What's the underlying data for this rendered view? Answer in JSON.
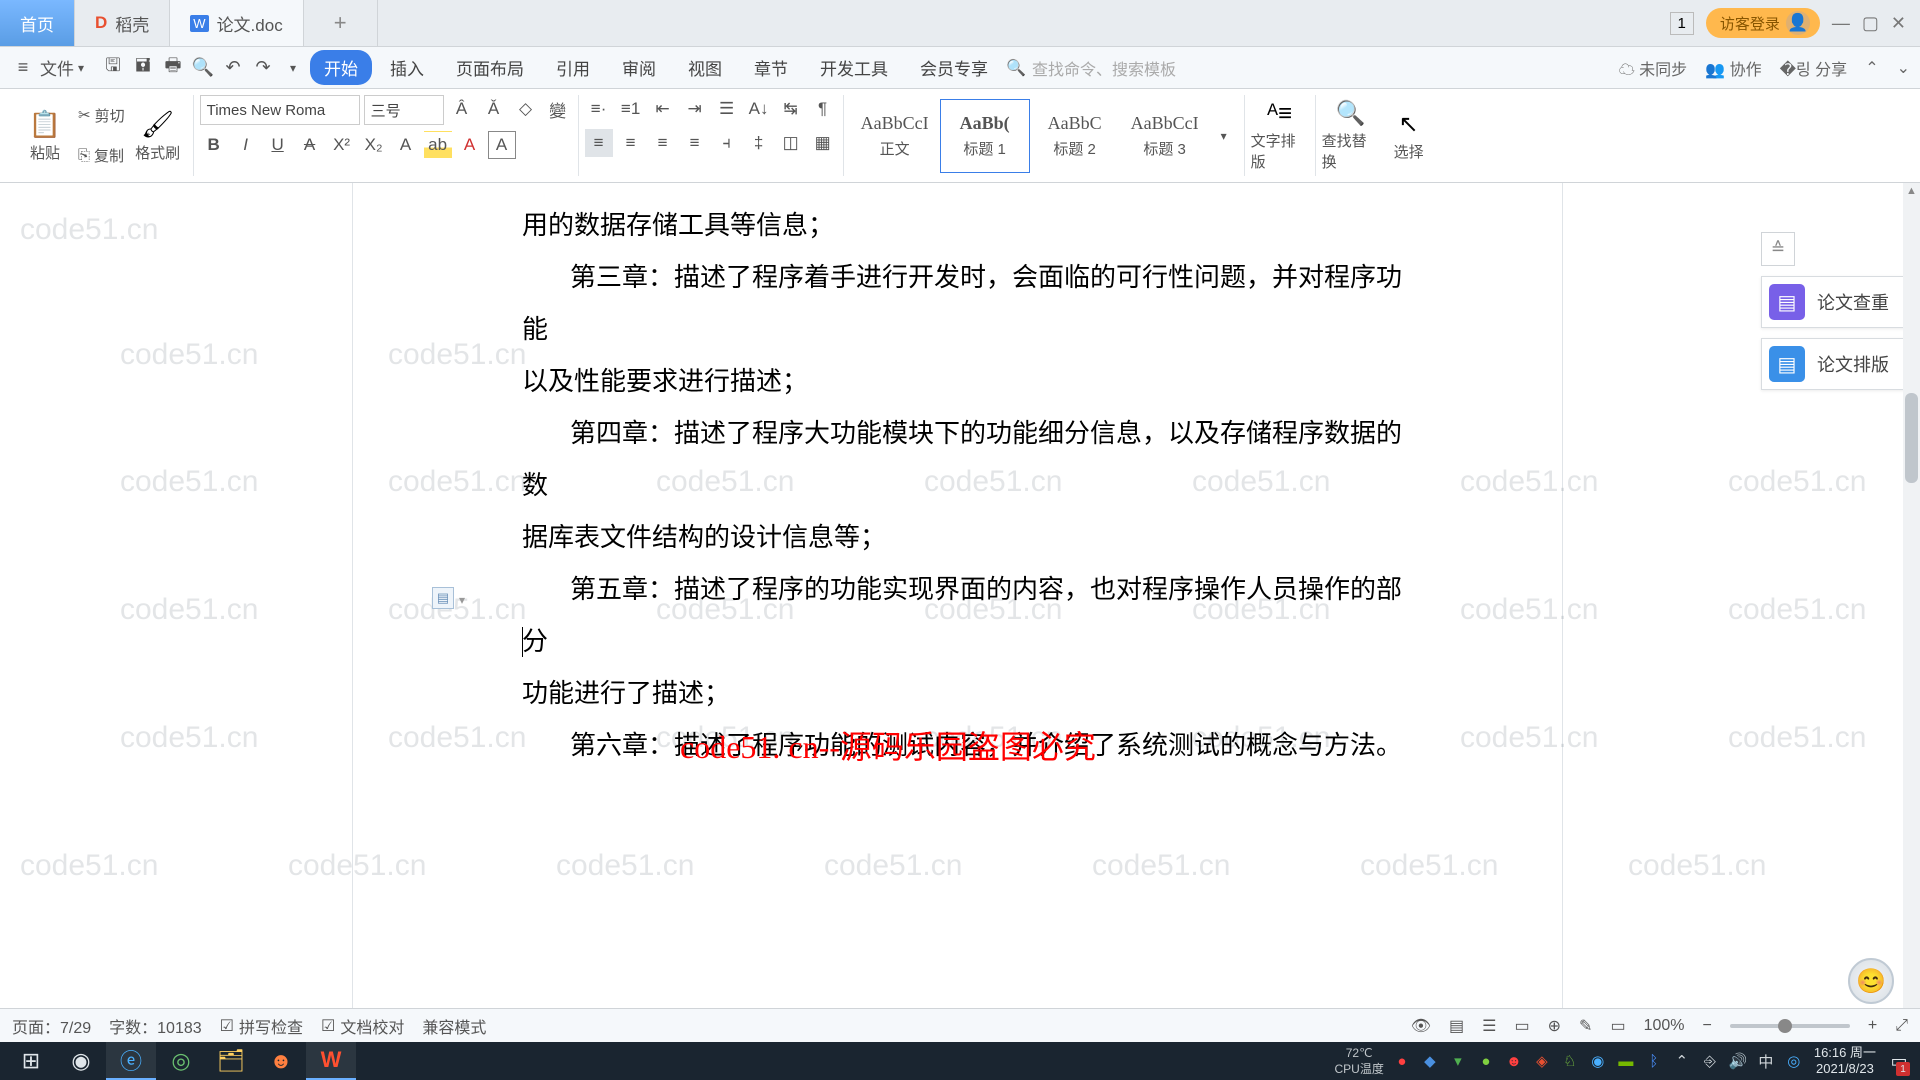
{
  "tabs": {
    "home": "首页",
    "daoke": "稻壳",
    "doc": "论文.doc"
  },
  "title_right": {
    "badge": "1",
    "login": "访客登录"
  },
  "menu": {
    "file": "文件",
    "items": [
      "开始",
      "插入",
      "页面布局",
      "引用",
      "审阅",
      "视图",
      "章节",
      "开发工具",
      "会员专享"
    ],
    "search_placeholder": "查找命令、搜索模板",
    "sync": "未同步",
    "collab": "协作",
    "share": "分享"
  },
  "ribbon": {
    "paste": "粘贴",
    "cut": "剪切",
    "copy": "复制",
    "brush": "格式刷",
    "font_name": "Times New Roma",
    "font_size": "三号",
    "styles": [
      {
        "sample": "AaBbCcI",
        "label": "正文"
      },
      {
        "sample": "AaBb(",
        "label": "标题 1"
      },
      {
        "sample": "AaBbC",
        "label": "标题 2"
      },
      {
        "sample": "AaBbCcI",
        "label": "标题 3"
      }
    ],
    "layout": "文字排版",
    "find": "查找替换",
    "select": "选择"
  },
  "doc": {
    "line1": "用的数据存储工具等信息；",
    "line2": "第三章：描述了程序着手进行开发时，会面临的可行性问题，并对程序功能",
    "line3": "以及性能要求进行描述；",
    "line4": "第四章：描述了程序大功能模块下的功能细分信息，以及存储程序数据的数",
    "line5": "据库表文件结构的设计信息等；",
    "line6": "第五章：描述了程序的功能实现界面的内容，也对程序操作人员操作的部分",
    "line7": "功能进行了描述；",
    "line8_pre": "第六章：描述了程序功能的测试内容，并介绍了系统测试的概念与方法。",
    "red_overlay": "code51. cn--源码乐园盗图必究",
    "watermark": "code51.cn"
  },
  "side": {
    "check": "论文查重",
    "layout": "论文排版"
  },
  "status": {
    "page": "页面：7/29",
    "words": "字数：10183",
    "spell": "拼写检查",
    "proof": "文档校对",
    "compat": "兼容模式",
    "zoom": "100%"
  },
  "taskbar": {
    "cpu_label": "CPU温度",
    "cpu_temp": "72℃",
    "time": "16:16 周一",
    "date": "2021/8/23",
    "notif": "1"
  }
}
